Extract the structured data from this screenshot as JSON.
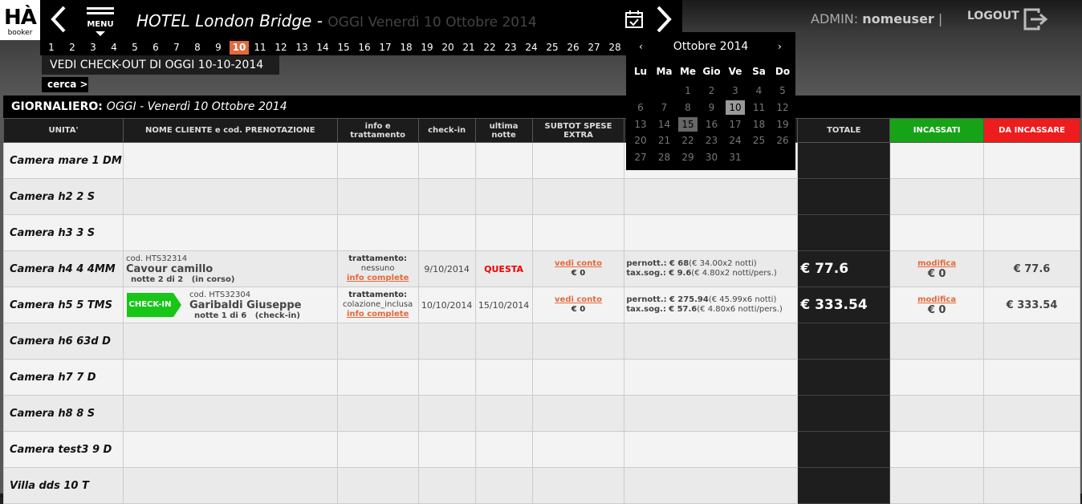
{
  "logo": {
    "mark": "HÀ",
    "sub": "booker"
  },
  "header": {
    "menu_label": "MENU",
    "hotel": "HOTEL London Bridge",
    "separator": " - ",
    "date": "OGGI Venerdì 10 Ottobre 2014",
    "admin_label": "ADMIN:",
    "admin_user": "nomeuser",
    "admin_sep": "|",
    "logout": "LOGOUT"
  },
  "days": [
    "1",
    "2",
    "3",
    "4",
    "5",
    "6",
    "7",
    "8",
    "9",
    "10",
    "11",
    "12",
    "13",
    "14",
    "15",
    "16",
    "17",
    "18",
    "19",
    "20",
    "21",
    "22",
    "23",
    "24",
    "25",
    "26",
    "27",
    "28"
  ],
  "selected_day": "10",
  "checkout_label": "VEDI CHECK-OUT DI OGGI 10-10-2014",
  "cerca_label": "cerca >",
  "panel": {
    "title": "GIORNALIERO:",
    "subtitle": "OGGI - Venerdì 10 Ottobre 2014"
  },
  "columns": {
    "unit": "UNITA'",
    "client": "NOME CLIENTE e cod. PRENOTAZIONE",
    "info_a": "info e",
    "info_b": "trattamento",
    "checkin": "check-in",
    "last_a": "ultima",
    "last_b": "notte",
    "extra_a": "SUBTOT SPESE",
    "extra_b": "EXTRA",
    "totale": "TOTALE",
    "incassati": "INCASSATI",
    "dainc": "DA INCASSARE"
  },
  "rows": [
    {
      "unit": "Camera mare 1 DM"
    },
    {
      "unit": "Camera h2 2 S"
    },
    {
      "unit": "Camera h3 3 S"
    },
    {
      "unit": "Camera h4 4 4MM",
      "code": "cod. HTS32314",
      "name": "Cavour camillo",
      "nights": "notte 2 di 2",
      "stay_status": "(in corso)",
      "treat_label": "trattamento:",
      "treat": "nessuno",
      "info_link": "info complete",
      "checkin": "9/10/2014",
      "last": "QUESTA",
      "vedi_conto": "vedi conto",
      "extra": "€ 0",
      "pern_label": "pernott.:",
      "pern_val": "€ 68",
      "pern_detail": "(€ 34.00x2 notti)",
      "tax_label": "tax.sog.:",
      "tax_val": "€ 9.6",
      "tax_detail": "(€ 4.80x2 notti/pers.)",
      "totale": "€ 77.6",
      "modifica": "modifica",
      "incassati": "€ 0",
      "dainc": "€ 77.6"
    },
    {
      "unit": "Camera h5 5 TMS",
      "badge": "CHECK-IN",
      "code": "cod. HTS32304",
      "name": "Garibaldi Giuseppe",
      "nights": "notte 1 di 6",
      "stay_status": "(check-in)",
      "treat_label": "trattamento:",
      "treat": "colazione_inclusa",
      "info_link": "info complete",
      "checkin": "10/10/2014",
      "last": "15/10/2014",
      "vedi_conto": "vedi conto",
      "extra": "€ 0",
      "pern_label": "pernott.:",
      "pern_val": "€ 275.94",
      "pern_detail": "(€ 45.99x6 notti)",
      "tax_label": "tax.sog.:",
      "tax_val": "€ 57.6",
      "tax_detail": "(€ 4.80x6 notti/pers.)",
      "totale": "€ 333.54",
      "modifica": "modifica",
      "incassati": "€ 0",
      "dainc": "€ 333.54"
    },
    {
      "unit": "Camera h6 63d D"
    },
    {
      "unit": "Camera h7 7 D"
    },
    {
      "unit": "Camera h8 8 S"
    },
    {
      "unit": "Camera test3 9 D"
    },
    {
      "unit": "Villa dds 10 T"
    }
  ],
  "calendar": {
    "month": "Ottobre 2014",
    "prev": "‹",
    "next": "›",
    "weekdays": [
      "Lu",
      "Ma",
      "Me",
      "Gio",
      "Ve",
      "Sa",
      "Do"
    ],
    "first_weekday_index": 2,
    "days_in_month": 31,
    "selected_day": 10,
    "today": 15
  },
  "icons": {
    "prev": "chevron-left-icon",
    "next": "chevron-right-icon",
    "calendar": "calendar-check-icon",
    "logout": "logout-icon"
  },
  "colors": {
    "accent": "#e26a3c",
    "incassati": "#17a317",
    "da_incassare": "#ee1c1c",
    "checkin_badge": "#17c617"
  }
}
